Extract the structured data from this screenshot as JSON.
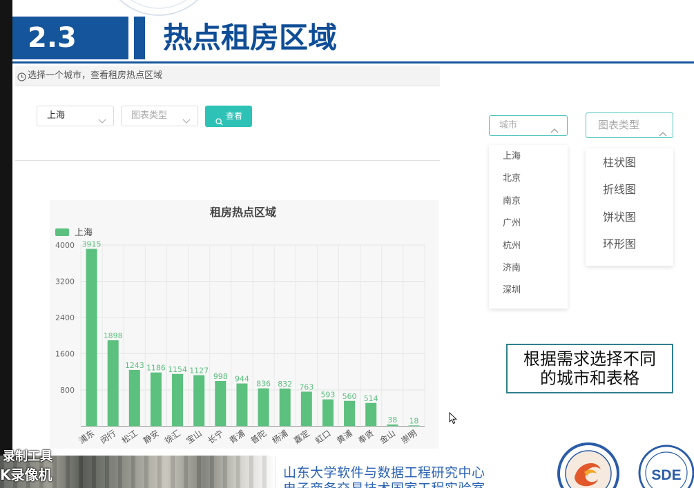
{
  "header": {
    "section_number": "2.3",
    "title": "热点租房区域"
  },
  "app": {
    "hint": "选择一个城市，查看租房热点区域",
    "city_select": {
      "value": "上海"
    },
    "chart_type_select": {
      "placeholder": "图表类型"
    },
    "query_button": "查看"
  },
  "demo": {
    "city_select": {
      "placeholder": "城市",
      "open": true,
      "options": [
        "上海",
        "北京",
        "南京",
        "广州",
        "杭州",
        "济南",
        "深圳"
      ]
    },
    "chart_type_select": {
      "placeholder": "图表类型",
      "open": true,
      "options": [
        "柱状图",
        "折线图",
        "饼状图",
        "环形图"
      ]
    },
    "note_lines": [
      "根据需求选择不同",
      "的城市和表格"
    ]
  },
  "footer": {
    "org_line1": "山东大学软件与数据工程研究中心",
    "org_line2": "电子商务交易技术国家工程实验室",
    "logo_text": "SDE",
    "recorder_line1": "录制工具",
    "recorder_line2": "K录像机"
  },
  "icons": {
    "hint": "clock-icon",
    "query": "search-icon",
    "select_closed": "chevron-down-icon",
    "select_open": "chevron-up-icon",
    "pointer": "mouse-cursor-icon"
  },
  "colors": {
    "brand_blue": "#15559c",
    "accent_teal": "#2ec2b6",
    "bar_green": "#5cc07f",
    "footer_blue": "#2a62b5"
  },
  "chart_data": {
    "type": "bar",
    "title": "租房热点区域",
    "categories": [
      "浦东",
      "闵行",
      "松江",
      "静安",
      "徐汇",
      "宝山",
      "长宁",
      "青浦",
      "普陀",
      "杨浦",
      "嘉定",
      "虹口",
      "黄浦",
      "奉贤",
      "金山",
      "崇明"
    ],
    "series": [
      {
        "name": "上海",
        "values": [
          3915,
          1898,
          1243,
          1186,
          1154,
          1127,
          998,
          944,
          836,
          832,
          763,
          593,
          560,
          514,
          38,
          18
        ]
      }
    ],
    "xlabel": "",
    "ylabel": "",
    "ylim": [
      0,
      4000
    ],
    "yticks": [
      800,
      1600,
      2400,
      3200,
      4000
    ],
    "grid": true,
    "data_labels": true,
    "legend": "top-left"
  }
}
